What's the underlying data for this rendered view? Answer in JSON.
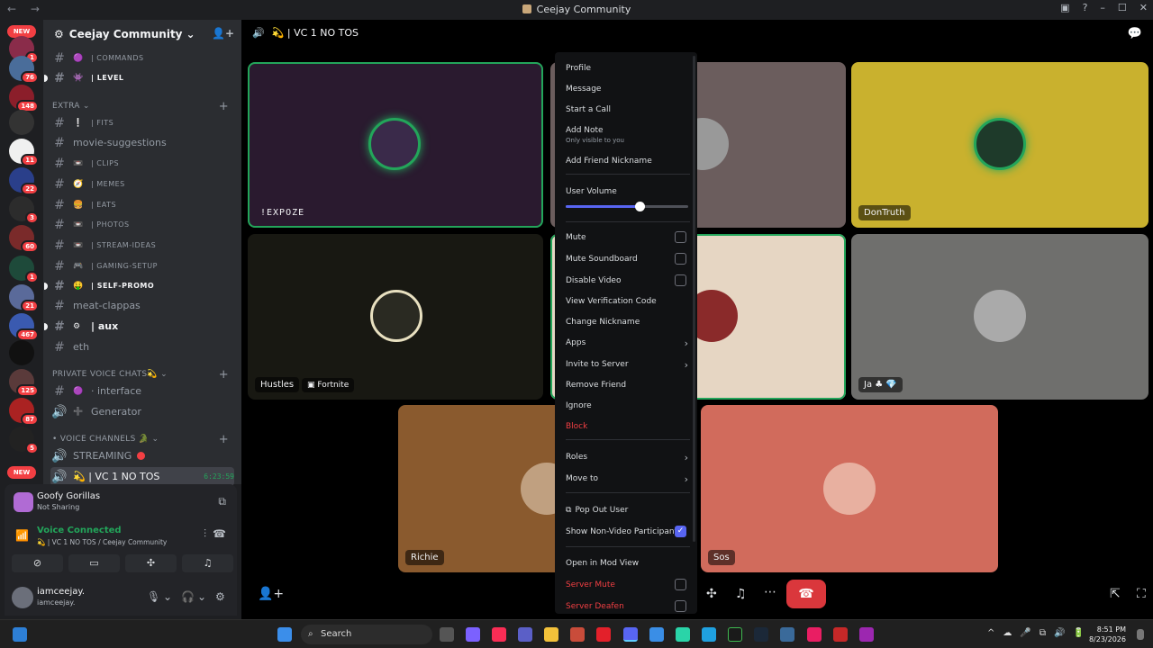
{
  "window": {
    "title": "Ceejay Community",
    "nav": "← →"
  },
  "server_rail": {
    "new_top": "NEW",
    "new_bottom": "NEW",
    "badges": [
      "1",
      "76",
      "148",
      "",
      "11",
      "22",
      "3",
      "60",
      "1",
      "21",
      "467",
      "",
      "125",
      "87",
      "5"
    ]
  },
  "guild": {
    "name": "Ceejay Community"
  },
  "channels": [
    {
      "emoji": "🟣",
      "label": "| COMMANDS",
      "style": "small",
      "bold": false,
      "unread": false
    },
    {
      "emoji": "👾",
      "label": "| LEVEL",
      "style": "small",
      "bold": true,
      "unread": true
    },
    {
      "emoji": "❕",
      "label": "| FITS",
      "style": "small",
      "bold": false,
      "unread": false
    },
    {
      "emoji": "",
      "label": "movie-suggestions",
      "style": "normal",
      "bold": false,
      "unread": false
    },
    {
      "emoji": "📼",
      "label": "| CLIPS",
      "style": "small",
      "bold": false,
      "unread": false
    },
    {
      "emoji": "🧭",
      "label": "| MEMES",
      "style": "small",
      "bold": false,
      "unread": false
    },
    {
      "emoji": "🍔",
      "label": "| EATS",
      "style": "small",
      "bold": false,
      "unread": false
    },
    {
      "emoji": "📼",
      "label": "| PHOTOS",
      "style": "small",
      "bold": false,
      "unread": false
    },
    {
      "emoji": "📼",
      "label": "| STREAM-IDEAS",
      "style": "small",
      "bold": false,
      "unread": false
    },
    {
      "emoji": "🎮",
      "label": "| GAMING-SETUP",
      "style": "small",
      "bold": false,
      "unread": false
    },
    {
      "emoji": "🤑",
      "label": "| SELF-PROMO",
      "style": "small",
      "bold": true,
      "unread": true
    },
    {
      "emoji": "",
      "label": "meat-clappas",
      "style": "normal",
      "bold": false,
      "unread": false
    },
    {
      "emoji": "⚙",
      "label": "| aux",
      "style": "normal",
      "bold": true,
      "unread": true
    },
    {
      "emoji": "",
      "label": "eth",
      "style": "normal",
      "bold": false,
      "unread": false
    }
  ],
  "categories": {
    "extra": "EXTRA",
    "private": "PRIVATE VOICE CHATS💫",
    "voice": "• VOICE CHANNELS 🐊"
  },
  "private_channels": [
    {
      "icon": "#",
      "emoji": "🟣",
      "label": "· interface"
    },
    {
      "icon": "🔊",
      "emoji": "➕",
      "label": "Generator"
    }
  ],
  "voice_channels": [
    {
      "label": "STREAMING",
      "live": true
    },
    {
      "label": "💫 | VC 1 NO TOS",
      "timer": "6:23:59",
      "active": true
    }
  ],
  "activity": {
    "title": "Goofy Gorillas",
    "subtitle": "Not Sharing"
  },
  "voice": {
    "status": "Voice Connected",
    "location": "💫 | VC 1 NO TOS / Ceejay Community"
  },
  "user": {
    "name": "iamceejay.",
    "tag": "iamceejay."
  },
  "stage": {
    "channel": "💫 | VC 1 NO TOS"
  },
  "tiles": [
    {
      "name": "!EXPOZE",
      "color": "#2a1a2f"
    },
    {
      "name": "",
      "color": "#6b5d5d"
    },
    {
      "name": "DonTruth",
      "color": "#c9b12e"
    },
    {
      "name": "Hustles",
      "game": "Fortnite",
      "color": "#181812"
    },
    {
      "name": "",
      "color": "#e6d6c3"
    },
    {
      "name": "Ja ♣ 💎",
      "color": "#6f6f6d"
    },
    {
      "name": "Richie",
      "color": "#8a5a2e"
    },
    {
      "name": "Sos",
      "color": "#d16b5c"
    }
  ],
  "context_menu": {
    "profile": "Profile",
    "message": "Message",
    "start_call": "Start a Call",
    "add_note": "Add Note",
    "add_note_sub": "Only visible to you",
    "add_nickname": "Add Friend Nickname",
    "user_volume": "User Volume",
    "volume_level": 0.6,
    "mute": "Mute",
    "mute_soundboard": "Mute Soundboard",
    "disable_video": "Disable Video",
    "verification": "View Verification Code",
    "change_nickname": "Change Nickname",
    "apps": "Apps",
    "invite": "Invite to Server",
    "remove_friend": "Remove Friend",
    "ignore": "Ignore",
    "block": "Block",
    "roles": "Roles",
    "move_to": "Move to",
    "pop_out": "Pop Out User",
    "show_nonvideo": "Show Non-Video Participants",
    "mod_view": "Open in Mod View",
    "server_mute": "Server Mute",
    "server_deafen": "Server Deafen"
  },
  "taskbar": {
    "search": "Search",
    "time": "8:51 PM",
    "date": "8/23/2026"
  },
  "colors": {
    "accent": "#5865f2",
    "green": "#23a55a",
    "red": "#f23f43",
    "bg": "#1e1f22"
  }
}
